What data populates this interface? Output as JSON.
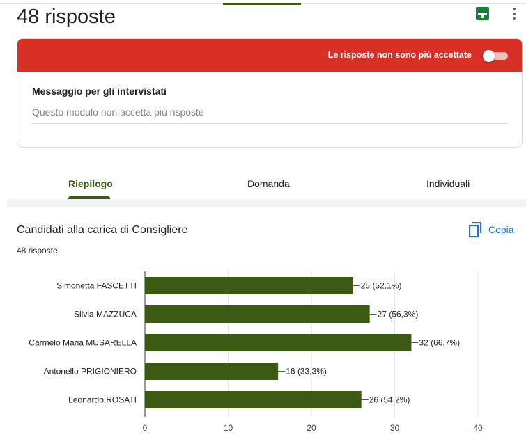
{
  "header": {
    "title": "48 risposte",
    "sheets_icon": "sheets-icon",
    "menu_icon": "more-vert-icon"
  },
  "responses_card": {
    "banner_text": "Le risposte non sono più accettate",
    "accepting_responses": false,
    "banner_color": "#d93025",
    "message_label": "Messaggio per gli intervistati",
    "message_value": "Questo modulo non accetta più risposte"
  },
  "tabs": [
    {
      "label": "Riepilogo",
      "active": true
    },
    {
      "label": "Domanda",
      "active": false
    },
    {
      "label": "Individuali",
      "active": false
    }
  ],
  "question": {
    "title": "Candidati alla carica di Consigliere",
    "response_count": "48 risposte",
    "copy_label": "Copia",
    "copy_icon": "copy-icon"
  },
  "colors": {
    "accent": "#3c5a14",
    "bar": "#3c5a14",
    "link": "#1a73e8"
  },
  "chart_data": {
    "type": "bar",
    "orientation": "horizontal",
    "categories": [
      "Simonetta FASCETTI",
      "Silvia MAZZUCA",
      "Carmelo Maria MUSARELLA",
      "Antonello PRIGIONIERO",
      "Leonardo ROSATI"
    ],
    "values": [
      25,
      27,
      32,
      16,
      26
    ],
    "labels": [
      "25 (52,1%)",
      "27 (56,3%)",
      "32 (66,7%)",
      "16 (33,3%)",
      "26 (54,2%)"
    ],
    "xlim": [
      0,
      40
    ],
    "xticks": [
      "0",
      "10",
      "20",
      "30",
      "40"
    ],
    "grid": true
  }
}
